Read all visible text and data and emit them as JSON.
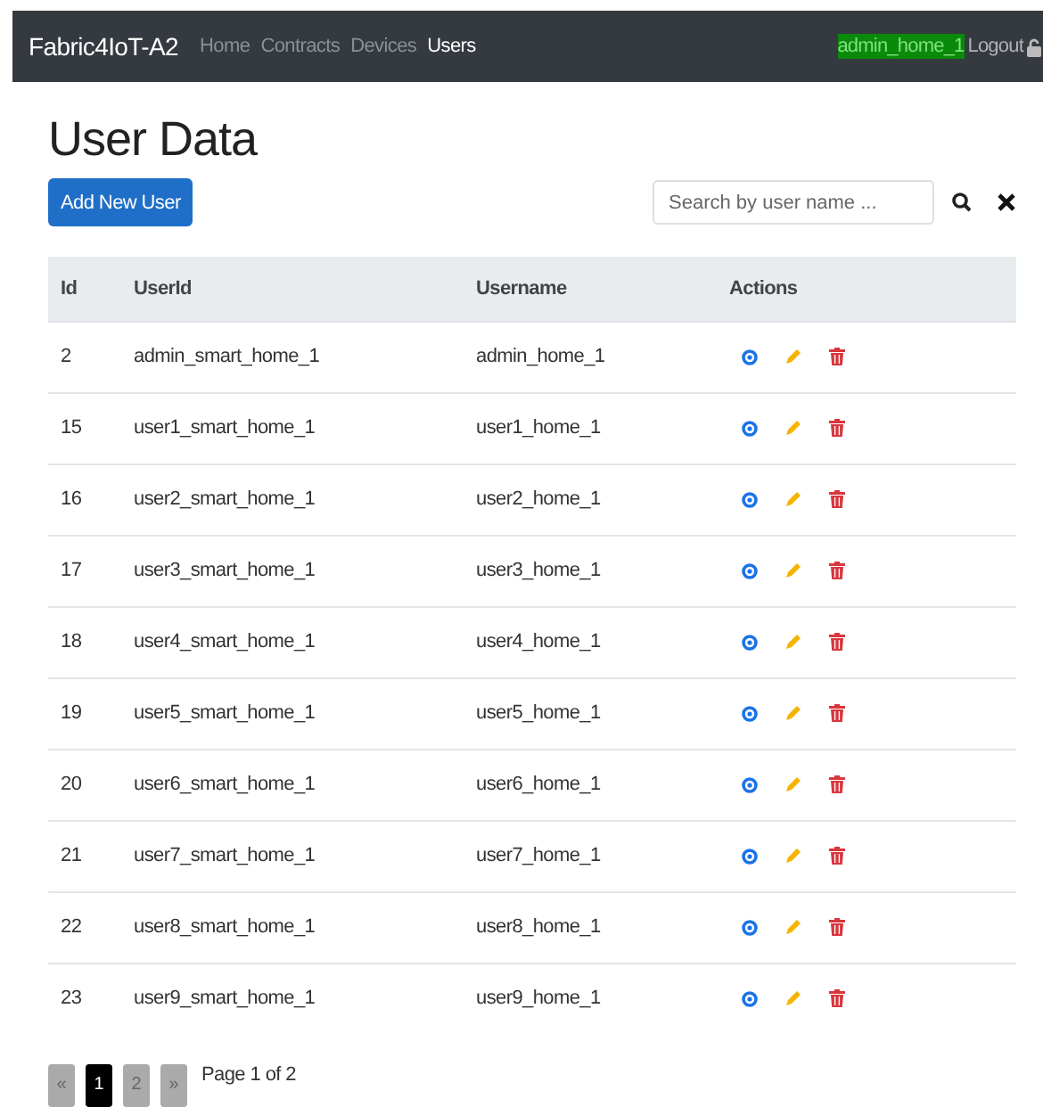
{
  "navbar": {
    "brand": "Fabric4IoT-A2",
    "links": [
      {
        "label": "Home",
        "selected": false
      },
      {
        "label": "Contracts",
        "selected": false
      },
      {
        "label": "Devices",
        "selected": false
      },
      {
        "label": "Users",
        "selected": true
      }
    ],
    "user": "admin_home_1",
    "logout": "Logout"
  },
  "title": "User Data",
  "add_button": "Add New User",
  "search": {
    "placeholder": "Search by user name ..."
  },
  "table": {
    "columns": [
      "Id",
      "UserId",
      "Username",
      "Actions"
    ],
    "rows": [
      {
        "id": "2",
        "user_id": "admin_smart_home_1",
        "username": "admin_home_1"
      },
      {
        "id": "15",
        "user_id": "user1_smart_home_1",
        "username": "user1_home_1"
      },
      {
        "id": "16",
        "user_id": "user2_smart_home_1",
        "username": "user2_home_1"
      },
      {
        "id": "17",
        "user_id": "user3_smart_home_1",
        "username": "user3_home_1"
      },
      {
        "id": "18",
        "user_id": "user4_smart_home_1",
        "username": "user4_home_1"
      },
      {
        "id": "19",
        "user_id": "user5_smart_home_1",
        "username": "user5_home_1"
      },
      {
        "id": "20",
        "user_id": "user6_smart_home_1",
        "username": "user6_home_1"
      },
      {
        "id": "21",
        "user_id": "user7_smart_home_1",
        "username": "user7_home_1"
      },
      {
        "id": "22",
        "user_id": "user8_smart_home_1",
        "username": "user8_home_1"
      },
      {
        "id": "23",
        "user_id": "user9_smart_home_1",
        "username": "user9_home_1"
      }
    ]
  },
  "pagination": {
    "prev": "«",
    "pages": [
      {
        "label": "1",
        "selected": true
      },
      {
        "label": "2",
        "selected": false
      }
    ],
    "next": "»",
    "info": "Page 1 of 2"
  }
}
